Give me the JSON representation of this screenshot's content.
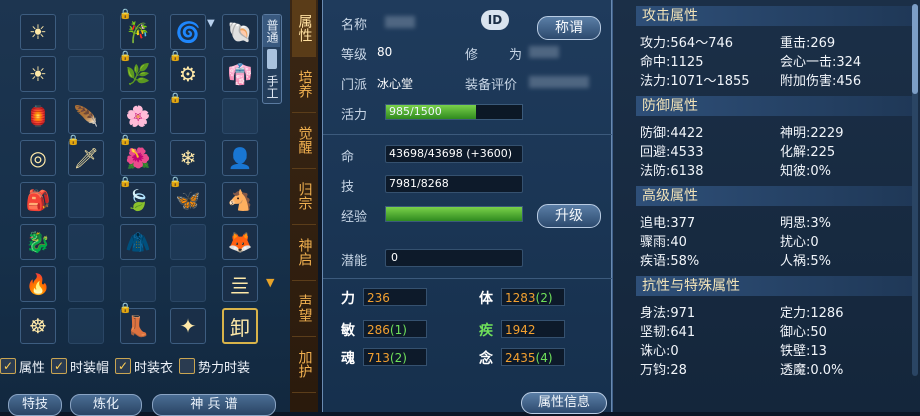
{
  "inventory": {
    "slots": [
      {
        "icon": "☀",
        "locked": false,
        "empty": false
      },
      {
        "icon": "",
        "locked": false,
        "empty": true
      },
      {
        "icon": "🎋",
        "locked": true,
        "empty": false
      },
      {
        "icon": "🌀",
        "locked": false,
        "empty": false
      },
      {
        "icon": "🐚",
        "locked": false,
        "empty": false
      },
      {
        "icon": "☀",
        "locked": false,
        "empty": false
      },
      {
        "icon": "",
        "locked": false,
        "empty": true
      },
      {
        "icon": "🌿",
        "locked": true,
        "empty": false
      },
      {
        "icon": "⚙",
        "locked": true,
        "empty": false
      },
      {
        "icon": "👘",
        "locked": false,
        "empty": false
      },
      {
        "icon": "🏮",
        "locked": false,
        "empty": false
      },
      {
        "icon": "🪶",
        "locked": false,
        "empty": false
      },
      {
        "icon": "🌸",
        "locked": false,
        "empty": false
      },
      {
        "icon": "",
        "locked": true,
        "empty": false
      },
      {
        "icon": "",
        "locked": false,
        "empty": true
      },
      {
        "icon": "◎",
        "locked": false,
        "empty": false
      },
      {
        "icon": "🗡",
        "locked": true,
        "empty": false
      },
      {
        "icon": "🌺",
        "locked": true,
        "empty": false
      },
      {
        "icon": "❄",
        "locked": false,
        "empty": false
      },
      {
        "icon": "👤",
        "locked": false,
        "empty": false
      },
      {
        "icon": "🎒",
        "locked": false,
        "empty": false
      },
      {
        "icon": "",
        "locked": false,
        "empty": true
      },
      {
        "icon": "🍃",
        "locked": true,
        "empty": false
      },
      {
        "icon": "🦋",
        "locked": true,
        "empty": false
      },
      {
        "icon": "🐴",
        "locked": false,
        "empty": false
      },
      {
        "icon": "🐉",
        "locked": false,
        "empty": false
      },
      {
        "icon": "",
        "locked": false,
        "empty": true
      },
      {
        "icon": "🧥",
        "locked": false,
        "empty": false
      },
      {
        "icon": "",
        "locked": false,
        "empty": true
      },
      {
        "icon": "🦊",
        "locked": false,
        "empty": false
      },
      {
        "icon": "🔥",
        "locked": false,
        "empty": false
      },
      {
        "icon": "",
        "locked": false,
        "empty": true
      },
      {
        "icon": "",
        "locked": false,
        "empty": true
      },
      {
        "icon": "",
        "locked": false,
        "empty": true
      },
      {
        "icon": "亖",
        "locked": false,
        "empty": false
      },
      {
        "icon": "☸",
        "locked": false,
        "empty": false
      },
      {
        "icon": "",
        "locked": false,
        "empty": true
      },
      {
        "icon": "👢",
        "locked": true,
        "empty": false
      },
      {
        "icon": "✦",
        "locked": false,
        "empty": false
      },
      {
        "icon": "卸",
        "locked": false,
        "empty": false
      }
    ],
    "vtabs": [
      "普通",
      "手工"
    ],
    "checkboxes": [
      {
        "label": "属性",
        "checked": true
      },
      {
        "label": "时装帽",
        "checked": true
      },
      {
        "label": "时装衣",
        "checked": true
      },
      {
        "label": "势力时装",
        "checked": false
      }
    ],
    "bottom_buttons": [
      "特技",
      "炼化",
      "神 兵 谱"
    ]
  },
  "category_tabs": [
    "属性",
    "培养",
    "觉醒",
    "归宗",
    "神启",
    "声望",
    "加护"
  ],
  "profile": {
    "name_label": "名称",
    "id_badge": "ID",
    "title_button": "称谓",
    "level_label": "等级",
    "level_value": "80",
    "cultivation_label": "修",
    "cultivation_label2": "为",
    "sect_label": "门派",
    "sect_value": "冰心堂",
    "gear_score_label": "装备评价",
    "vitality_label": "活力",
    "vitality_value": "985/1500",
    "vitality_fill": 0.66,
    "hp_label": "命",
    "hp_value": "43698/43698 (+3600)",
    "mp_label": "技",
    "mp_value": "7981/8268",
    "exp_label": "经验",
    "exp_fill": 1.0,
    "upgrade_button": "升级",
    "potential_label": "潜能",
    "potential_value": "0",
    "info_button": "属性信息"
  },
  "attributes": [
    {
      "name": "力",
      "value": "236",
      "bonus": ""
    },
    {
      "name": "体",
      "value": "1283",
      "bonus": "(2)"
    },
    {
      "name": "敏",
      "value": "286",
      "bonus": "(1)"
    },
    {
      "name": "疾",
      "value": "1942",
      "bonus": ""
    },
    {
      "name": "魂",
      "value": "713",
      "bonus": "(2)"
    },
    {
      "name": "念",
      "value": "2435",
      "bonus": "(4)"
    }
  ],
  "stats": {
    "attack_head": "攻击属性",
    "attack": [
      "攻力:564～746",
      "重击:269",
      "命中:1125",
      "会心一击:324",
      "法力:1071～1855",
      "附加伤害:456"
    ],
    "defense_head": "防御属性",
    "defense": [
      "防御:4422",
      "神明:2229",
      "回避:4533",
      "化解:225",
      "法防:6138",
      "知彼:0%"
    ],
    "advanced_head": "高级属性",
    "advanced": [
      "追电:377",
      "明思:3%",
      "骤雨:40",
      "扰心:0",
      "疾语:58%",
      "人祸:5%"
    ],
    "resist_head": "抗性与特殊属性",
    "resist": [
      "身法:971",
      "定力:1286",
      "坚韧:641",
      "御心:50",
      "诛心:0",
      "铁壁:13",
      "万钧:28",
      "透魔:0.0%"
    ]
  },
  "colors": {
    "accent": "#f2a030",
    "bonus": "#6fe05a",
    "bar": "#4caf2a"
  }
}
